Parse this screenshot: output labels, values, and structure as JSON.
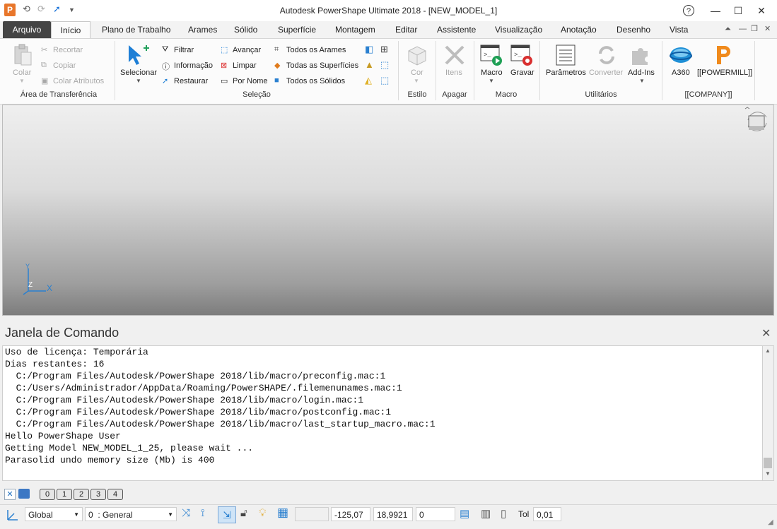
{
  "window": {
    "title": "Autodesk PowerShape Ultimate 2018 - [NEW_MODEL_1]",
    "logo_letter": "P"
  },
  "tabs": [
    "Arquivo",
    "Início",
    "Plano de Trabalho",
    "Arames",
    "Sólido",
    "Superfície",
    "Montagem",
    "Editar",
    "Assistente",
    "Visualização",
    "Anotação",
    "Desenho",
    "Vista"
  ],
  "ribbon": {
    "clipboard": {
      "paste": "Colar",
      "cut": "Recortar",
      "copy": "Copiar",
      "copy_attr": "Colar Atributos",
      "label": "Área de Transferência"
    },
    "selection": {
      "select": "Selecionar",
      "filter": "Filtrar",
      "info": "Informação",
      "restore": "Restaurar",
      "advance": "Avançar",
      "clear": "Limpar",
      "by_name": "Por Nome",
      "all_wires": "Todos os Arames",
      "all_surfaces": "Todas as Superfícies",
      "all_solids": "Todos os Sólidos",
      "label": "Seleção"
    },
    "style": {
      "color": "Cor",
      "label": "Estilo"
    },
    "delete": {
      "items": "Itens",
      "label": "Apagar"
    },
    "macro": {
      "macro": "Macro",
      "record": "Gravar",
      "label": "Macro"
    },
    "utilities": {
      "params": "Parâmetros",
      "convert": "Converter",
      "addins": "Add-Ins",
      "label": "Utilitários"
    },
    "company": {
      "a360": "A360",
      "powermill": "[[POWERMILL]]",
      "label": "[[COMPANY]]"
    }
  },
  "axis": {
    "x": "X",
    "y": "Y",
    "z": "Z"
  },
  "command_window": {
    "title": "Janela de Comando",
    "lines": [
      "Uso de licença: Temporária",
      "Dias restantes: 16",
      "  C:/Program Files/Autodesk/PowerShape 2018/lib/macro/preconfig.mac:1",
      "  C:/Users/Administrador/AppData/Roaming/PowerSHAPE/.filemenunames.mac:1",
      "  C:/Program Files/Autodesk/PowerShape 2018/lib/macro/login.mac:1",
      "  C:/Program Files/Autodesk/PowerShape 2018/lib/macro/postconfig.mac:1",
      "  C:/Program Files/Autodesk/PowerShape 2018/lib/macro/last_startup_macro.mac:1",
      "Hello PowerShape User",
      "Getting Model NEW_MODEL_1_25, please wait ...",
      "Parasolid undo memory size (Mb) is 400"
    ]
  },
  "levels": [
    "0",
    "1",
    "2",
    "3",
    "4"
  ],
  "status": {
    "workplane": "Global",
    "level": "0  : General",
    "x": "-125,07",
    "y": "18,9921",
    "z": "0",
    "tol_label": "Tol",
    "tol_value": "0,01"
  }
}
